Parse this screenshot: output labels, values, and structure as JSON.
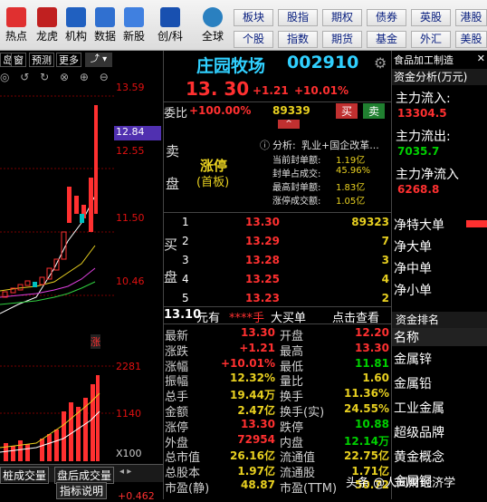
{
  "toolbar": {
    "items": [
      "热点",
      "龙虎",
      "机构",
      "数据",
      "新股",
      "创/科",
      "全球"
    ],
    "quick": [
      "板块",
      "股指",
      "期权",
      "债券",
      "英股",
      "港股",
      "个股",
      "指数",
      "期货",
      "基金",
      "外汇",
      "美股"
    ]
  },
  "left": {
    "tabs": [
      "岛",
      "窗",
      "预测",
      "更多"
    ],
    "price_labels": [
      "13.59",
      "12.55",
      "12.84",
      "11.50",
      "10.46"
    ],
    "vol_labels": [
      "2281",
      "1140",
      "X100"
    ],
    "zhang": "涨",
    "bottom_tabs": [
      "桩成交量",
      "盘后成交量",
      "指标说明"
    ],
    "bottom_val": "+0.462"
  },
  "header": {
    "name": "庄园牧场",
    "code": "002910",
    "price": "13. 30",
    "chg": "+1.21",
    "pct": "+10.01%"
  },
  "weibi": {
    "label": "委比",
    "pct": "+100.00%",
    "vol": "89339",
    "buy": "买",
    "sell": "卖"
  },
  "limit": {
    "title": "涨停",
    "sub": "(首板)",
    "analysis_label": "分析:",
    "analysis": "乳业+国企改革...",
    "rows": [
      [
        "当前封单额:",
        "1.19亿"
      ],
      [
        "封单占成交:",
        "45.96%"
      ],
      [
        "最高封单额:",
        "1.83亿"
      ],
      [
        "涨停成交额:",
        "1.05亿"
      ]
    ]
  },
  "sell_label": [
    "卖",
    "盘"
  ],
  "buy_label": [
    "买",
    "",
    "盘"
  ],
  "bids": [
    [
      "1",
      "13.30",
      "89323"
    ],
    [
      "2",
      "13.29",
      "7"
    ],
    [
      "3",
      "13.28",
      "3"
    ],
    [
      "4",
      "13.25",
      "4"
    ],
    [
      "5",
      "13.23",
      "2"
    ]
  ],
  "ticker": {
    "price": "13.10",
    "unit": "元有",
    "stars": "****手",
    "big": "大买单",
    "view": "点击查看"
  },
  "quote": [
    [
      "最新",
      "13.30",
      "开盘",
      "12.20"
    ],
    [
      "涨跌",
      "+1.21",
      "最高",
      "13.30"
    ],
    [
      "涨幅",
      "+10.01%",
      "最低",
      "11.81"
    ],
    [
      "振幅",
      "12.32%",
      "量比",
      "1.60"
    ],
    [
      "总手",
      "19.44万",
      "换手",
      "11.36%"
    ],
    [
      "金额",
      "2.47亿",
      "换手(实)",
      "24.55%"
    ],
    [
      "涨停",
      "13.30",
      "跌停",
      "10.88"
    ],
    [
      "外盘",
      "72954",
      "内盘",
      "12.14万"
    ],
    [
      "总市值",
      "26.16亿",
      "流通值",
      "22.75亿"
    ],
    [
      "总股本",
      "1.97亿",
      "流通股",
      "1.71亿"
    ],
    [
      "市盈(静)",
      "48.87",
      "市盈(TTM)",
      "50.72"
    ]
  ],
  "right": {
    "industry": "食品加工制造",
    "fund_title": "资金分析(万元)",
    "in_label": "主力流入:",
    "in_val": "13304.5",
    "out_label": "主力流出:",
    "out_val": "7035.7",
    "net_label": "主力净流入",
    "net_val": "6268.8",
    "flows": [
      "净特大单",
      "净大单",
      "净中单",
      "净小单"
    ],
    "rank_title": "资金排名",
    "rank_header": "名称",
    "ranks": [
      "金属锌",
      "金属铅",
      "工业金属",
      "超级品牌",
      "黄金概念",
      "金属铜"
    ]
  },
  "watermark": "头条 @人间财经济学"
}
